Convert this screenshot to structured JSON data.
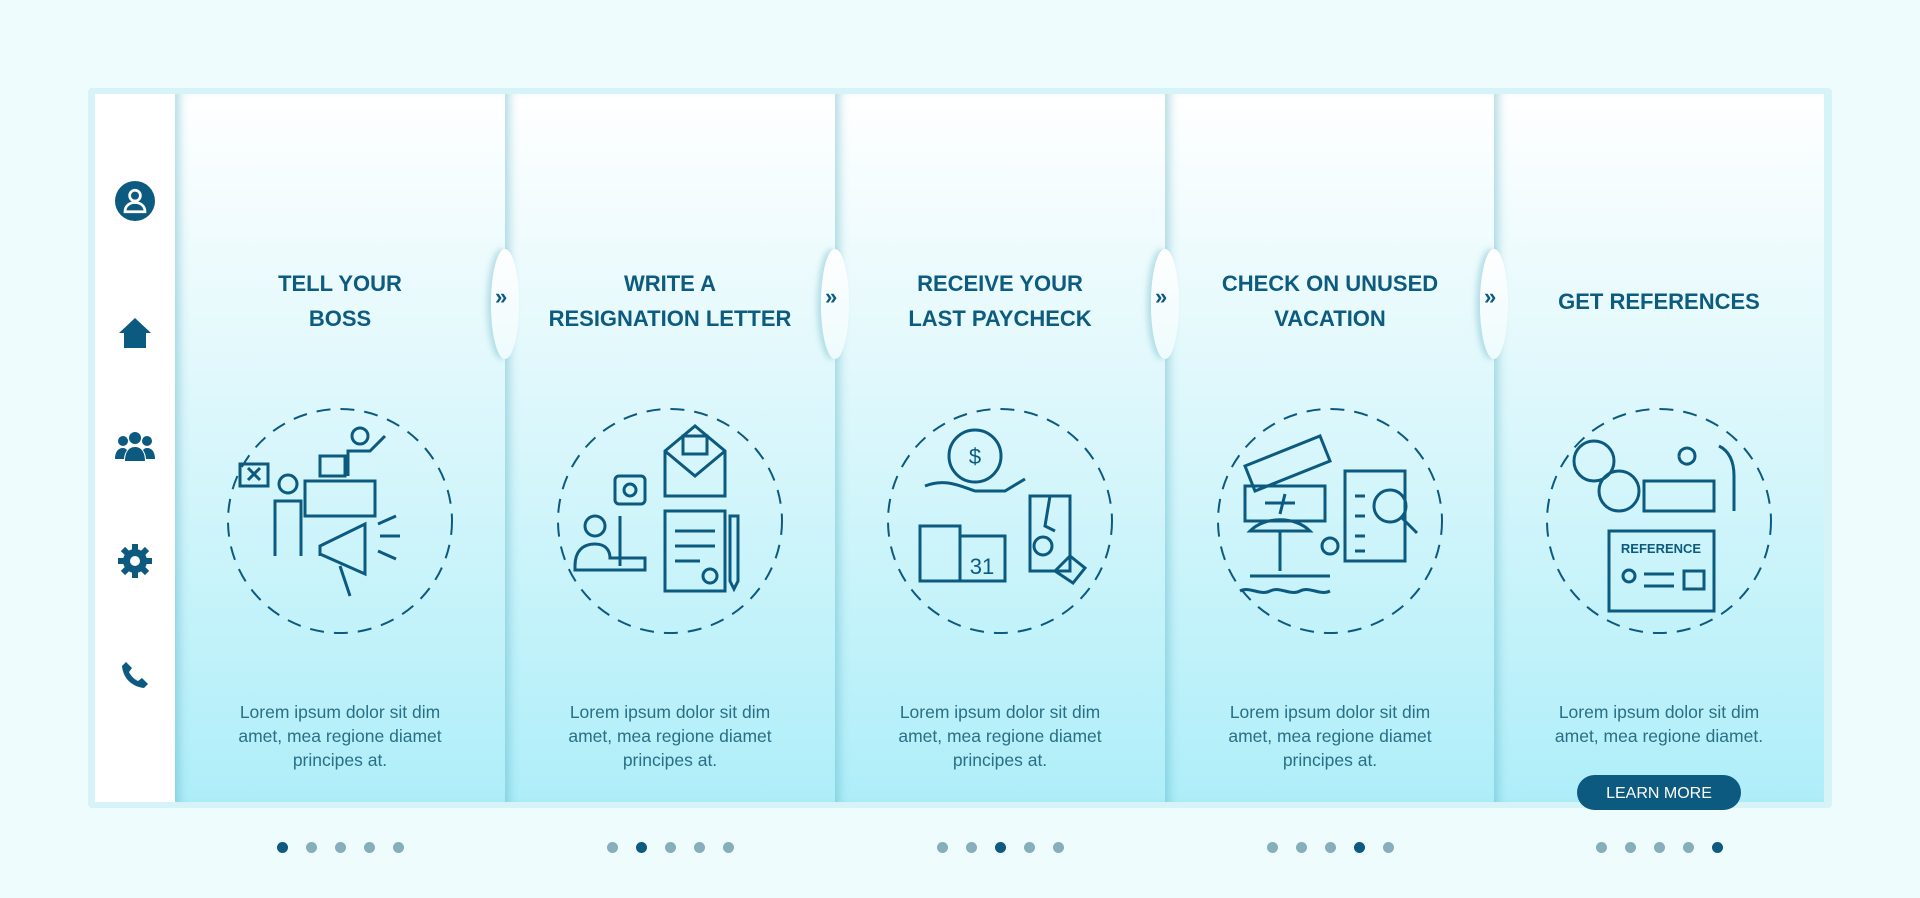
{
  "colors": {
    "accent": "#0c5a80",
    "text": "#2a6f86",
    "dot_inactive": "#86aebb"
  },
  "sidebar": {
    "items": [
      {
        "icon": "user-icon"
      },
      {
        "icon": "home-icon"
      },
      {
        "icon": "group-icon"
      },
      {
        "icon": "gear-icon"
      },
      {
        "icon": "phone-icon"
      }
    ]
  },
  "next_glyph": "»",
  "steps": [
    {
      "title": [
        "TELL YOUR",
        "BOSS"
      ],
      "body": [
        "Lorem ipsum dolor sit dim",
        "amet, mea regione diamet",
        "principes at."
      ],
      "active_dot": 0,
      "icon": "tell-boss-illustration"
    },
    {
      "title": [
        "WRITE A",
        "RESIGNATION LETTER"
      ],
      "body": [
        "Lorem ipsum dolor sit dim",
        "amet, mea regione diamet",
        "principes at."
      ],
      "active_dot": 1,
      "icon": "resignation-letter-illustration"
    },
    {
      "title": [
        "RECEIVE YOUR",
        "LAST PAYCHECK"
      ],
      "body": [
        "Lorem ipsum dolor sit dim",
        "amet, mea regione diamet",
        "principes at."
      ],
      "active_dot": 2,
      "icon": "paycheck-illustration"
    },
    {
      "title": [
        "CHECK ON UNUSED",
        "VACATION"
      ],
      "body": [
        "Lorem ipsum dolor sit dim",
        "amet, mea regione diamet",
        "principes at."
      ],
      "active_dot": 3,
      "icon": "vacation-illustration"
    },
    {
      "title": [
        "GET REFERENCES"
      ],
      "body": [
        "Lorem ipsum dolor sit dim",
        "amet, mea regione diamet."
      ],
      "active_dot": 4,
      "icon": "references-illustration",
      "button": "LEARN MORE",
      "illus_text": "REFERENCE"
    }
  ],
  "dot_count": 5
}
